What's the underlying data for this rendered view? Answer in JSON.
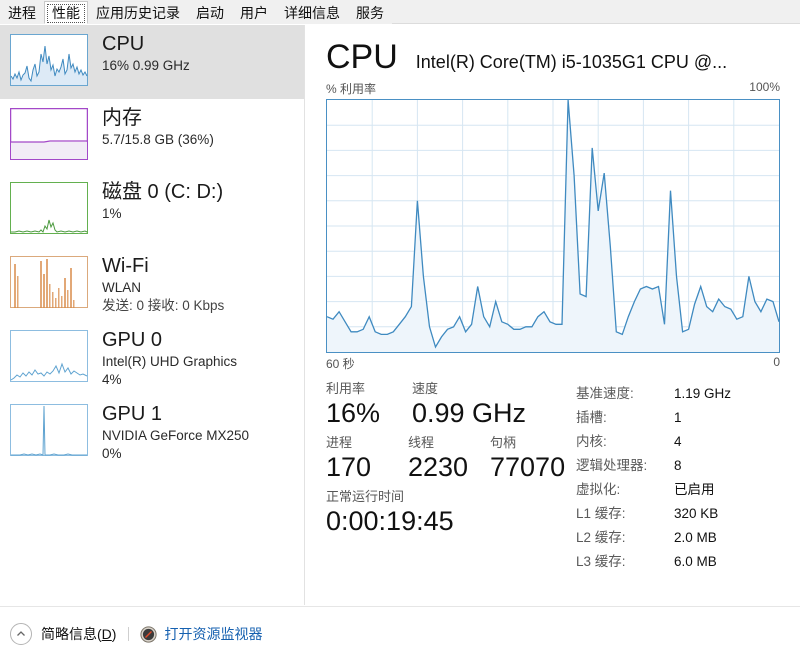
{
  "window": {
    "tabs": [
      {
        "label": "进程",
        "selected": false
      },
      {
        "label": "性能",
        "selected": true
      },
      {
        "label": "应用历史记录",
        "selected": false
      },
      {
        "label": "启动",
        "selected": false
      },
      {
        "label": "用户",
        "selected": false
      },
      {
        "label": "详细信息",
        "selected": false
      },
      {
        "label": "服务",
        "selected": false
      }
    ]
  },
  "sidebar": {
    "items": [
      {
        "id": "cpu",
        "title": "CPU",
        "sub1": "16%  0.99 GHz",
        "sub2": "",
        "active": true,
        "color": "#3f8ac0",
        "fill": "#eef4fa",
        "spark": [
          28,
          22,
          55,
          25,
          20,
          30,
          24,
          26,
          18,
          95,
          35,
          22,
          58,
          40,
          30,
          68,
          45,
          25,
          60,
          30,
          38,
          26,
          44,
          30,
          22,
          35,
          28,
          42,
          26,
          30,
          55,
          34,
          26,
          38,
          30,
          24,
          32,
          28,
          36,
          30
        ]
      },
      {
        "id": "memory",
        "title": "内存",
        "sub1": "5.7/15.8 GB (36%)",
        "sub2": "",
        "active": false,
        "color": "#a348c8",
        "fill": "#f3ebf7",
        "level": 36
      },
      {
        "id": "disk0",
        "title": "磁盘 0 (C: D:)",
        "sub1": "1%",
        "sub2": "",
        "active": false,
        "color": "#4c9a3f",
        "fill": "#ffffff",
        "spark": [
          2,
          3,
          2,
          4,
          3,
          2,
          5,
          3,
          2,
          4,
          3,
          6,
          3,
          2,
          4,
          3,
          5,
          3,
          2,
          4,
          3,
          8,
          22,
          12,
          30,
          10,
          6,
          4,
          3,
          5,
          3,
          2,
          4,
          3,
          2,
          3,
          2,
          4,
          3,
          2
        ]
      },
      {
        "id": "wifi",
        "title": "Wi-Fi",
        "sub1": "WLAN",
        "sub2": "发送: 0 接收: 0 Kbps",
        "active": false,
        "color": "#c1702f",
        "fill": "#fbeee3",
        "spark": [
          2,
          78,
          6,
          3,
          2,
          4,
          3,
          2,
          4,
          3,
          2,
          3,
          2,
          70,
          30,
          88,
          22,
          60,
          18,
          8,
          14,
          6,
          30,
          12,
          5,
          48,
          18,
          6,
          10,
          4,
          3,
          2,
          4,
          3,
          2,
          3,
          2,
          4,
          3,
          2
        ]
      },
      {
        "id": "gpu0",
        "title": "GPU 0",
        "sub1": "Intel(R) UHD Graphics",
        "sub2": "4%",
        "active": false,
        "color": "#4a90c4",
        "fill": "#ffffff",
        "spark": [
          3,
          8,
          14,
          9,
          16,
          10,
          18,
          11,
          20,
          12,
          15,
          9,
          14,
          10,
          16,
          22,
          12,
          30,
          14,
          24,
          10,
          18,
          12,
          16,
          10,
          14,
          22,
          12,
          26,
          14,
          18,
          11,
          16,
          10,
          14,
          9,
          13,
          8,
          12,
          7
        ]
      },
      {
        "id": "gpu1",
        "title": "GPU 1",
        "sub1": "NVIDIA GeForce MX250",
        "sub2": "0%",
        "active": false,
        "color": "#4a90c4",
        "fill": "#ffffff",
        "spark": [
          1,
          2,
          1,
          2,
          1,
          3,
          2,
          1,
          2,
          3,
          2,
          1,
          2,
          1,
          2,
          3,
          98,
          4,
          2,
          1,
          2,
          1,
          2,
          3,
          2,
          1,
          2,
          1,
          2,
          1,
          2,
          1,
          2,
          1,
          2,
          1,
          2,
          1,
          2,
          1
        ]
      }
    ]
  },
  "main": {
    "heading": "CPU",
    "model": "Intel(R) Core(TM) i5-1035G1 CPU @...",
    "axis_y_label": "% 利用率",
    "axis_y_max": "100%",
    "axis_x_left": "60 秒",
    "axis_x_right": "0",
    "stats": [
      {
        "label": "利用率",
        "value": "16%"
      },
      {
        "label": "速度",
        "value": "0.99 GHz"
      },
      {
        "label": "进程",
        "value": "170"
      },
      {
        "label": "线程",
        "value": "2230"
      },
      {
        "label": "句柄",
        "value": "77070"
      },
      {
        "label": "正常运行时间",
        "value": "0:00:19:45"
      }
    ],
    "specs": [
      {
        "key": "基准速度:",
        "value": "1.19 GHz"
      },
      {
        "key": "插槽:",
        "value": "1"
      },
      {
        "key": "内核:",
        "value": "4"
      },
      {
        "key": "逻辑处理器:",
        "value": "8"
      },
      {
        "key": "虚拟化:",
        "value": "已启用"
      },
      {
        "key": "L1 缓存:",
        "value": "320 KB"
      },
      {
        "key": "L2 缓存:",
        "value": "2.0 MB"
      },
      {
        "key": "L3 缓存:",
        "value": "6.0 MB"
      }
    ]
  },
  "chart_data": {
    "type": "area",
    "title": "CPU 利用率",
    "xlabel": "60 秒",
    "ylabel": "% 利用率",
    "ylim": [
      0,
      100
    ],
    "xlim": [
      60,
      0
    ],
    "grid": true,
    "legend": "none",
    "line_color": "#3f8ac0",
    "fill_color": "#eef5fb",
    "values": [
      14,
      13,
      16,
      12,
      8,
      8,
      9,
      14,
      8,
      7,
      7,
      8,
      11,
      14,
      18,
      60,
      30,
      10,
      2,
      6,
      9,
      10,
      14,
      8,
      11,
      26,
      14,
      10,
      20,
      12,
      11,
      9,
      9,
      10,
      10,
      14,
      16,
      12,
      11,
      11,
      100,
      70,
      23,
      22,
      81,
      56,
      71,
      42,
      8,
      7,
      14,
      20,
      25,
      26,
      25,
      26,
      11,
      64,
      30,
      8,
      9,
      19,
      26,
      18,
      16,
      21,
      18,
      17,
      13,
      14,
      30,
      20,
      16,
      21,
      20,
      12
    ]
  },
  "statusbar": {
    "collapse_label_prefix": "简略信息(",
    "collapse_label_key": "D",
    "collapse_label_suffix": ")",
    "resource_monitor_link": "打开资源监视器"
  },
  "colors": {
    "accent_blue": "#3f8ac0",
    "link_blue": "#1560b0",
    "memory_purple": "#a348c8",
    "disk_green": "#4c9a3f",
    "wifi_orange": "#c1702f",
    "selection_gray": "#e0e0e0"
  }
}
